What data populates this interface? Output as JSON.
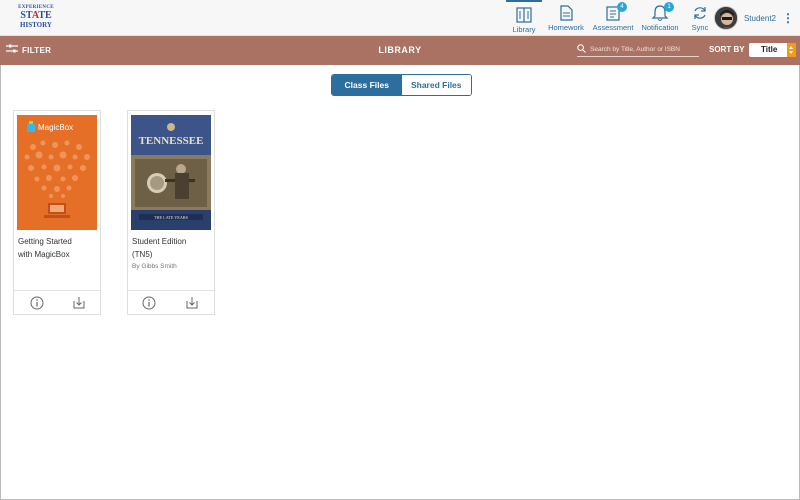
{
  "brand": {
    "line1": "EXPERIENCE",
    "line2_pre": "ST",
    "line2_star": "A",
    "line2_post": "TE",
    "line3": "HISTORY"
  },
  "nav": {
    "items": [
      {
        "label": "Library",
        "icon": "library-icon",
        "active": true
      },
      {
        "label": "Homework",
        "icon": "homework-icon"
      },
      {
        "label": "Assessment",
        "icon": "assessment-icon",
        "badge": "4"
      },
      {
        "label": "Notification",
        "icon": "bell-icon",
        "badge": "1"
      },
      {
        "label": "Sync",
        "icon": "sync-icon"
      }
    ],
    "user_name": "Student2"
  },
  "library_bar": {
    "filter_label": "FILTER",
    "title": "LIBRARY",
    "search_placeholder": "Search by Title, Author or ISBN",
    "sort_label": "SORT BY",
    "sort_value": "Title"
  },
  "tabs": [
    {
      "label": "Class Files",
      "active": true
    },
    {
      "label": "Shared Files",
      "active": false
    }
  ],
  "books": [
    {
      "title_line1": "Getting Started",
      "title_line2": "with MagicBox",
      "author": "",
      "cover_brand": "MagicBox"
    },
    {
      "title_line1": "Student Edition",
      "title_line2": "(TN5)",
      "author": "By Gibbs Smith",
      "cover_title": "TENNESSEE",
      "cover_subtitle": "THE LATE YEARS"
    }
  ],
  "colors": {
    "accent": "#2c6f9e",
    "library_bar": "#a97263",
    "badge": "#2aa6d6",
    "sort_arrow": "#f39c12",
    "magicbox_orange": "#e66f27"
  }
}
